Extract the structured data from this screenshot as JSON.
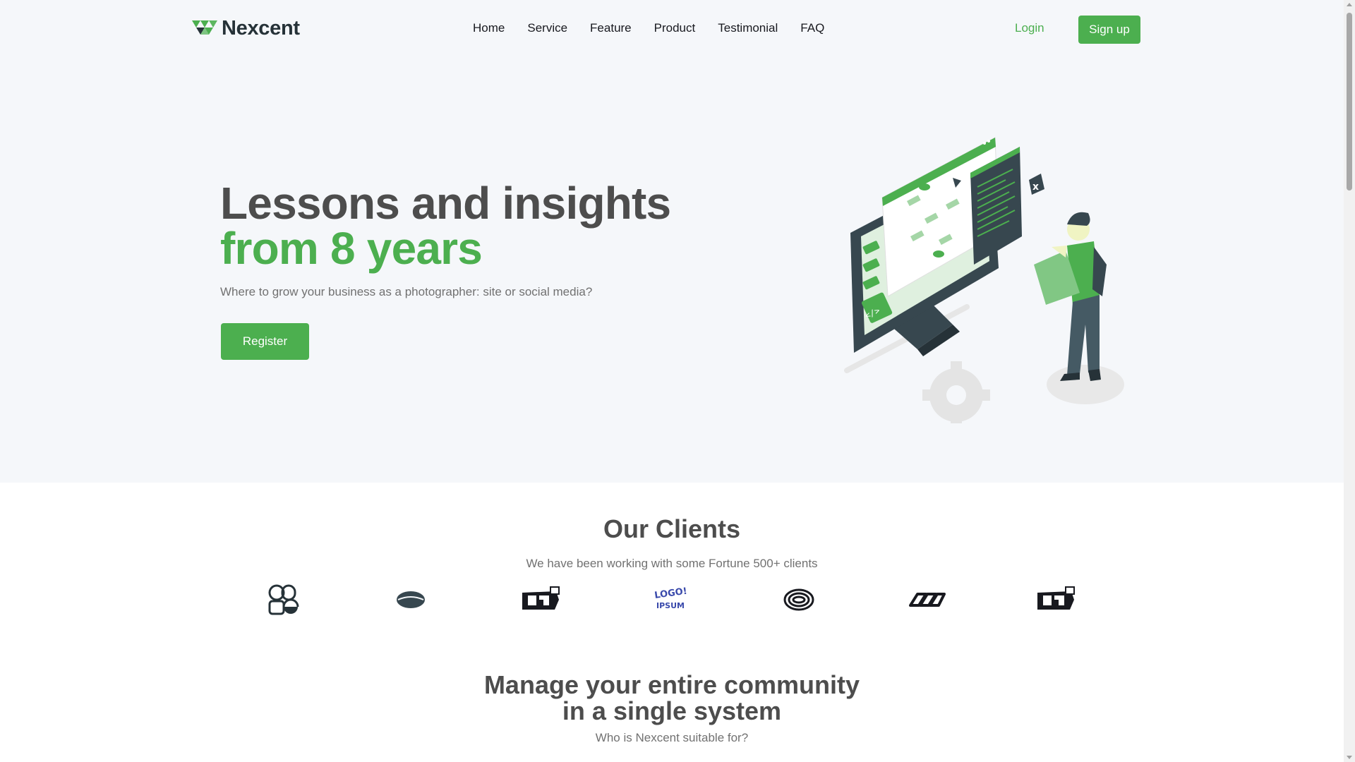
{
  "brand": {
    "name": "Nexcent",
    "logo_icon": "triangles-logo-icon",
    "accent_color": "#4caf4f"
  },
  "nav": {
    "links": [
      "Home",
      "Service",
      "Feature",
      "Product",
      "Testimonial",
      "FAQ"
    ],
    "login_label": "Login",
    "signup_label": "Sign up"
  },
  "hero": {
    "title_line1": "Lessons and insights",
    "title_line2": "from 8 years",
    "subtitle": "Where to grow your business as a photographer: site or social media?",
    "register_label": "Register",
    "illustration": "developer-monitor-illustration"
  },
  "clients": {
    "title": "Our Clients",
    "subtitle": "We have been working with some Fortune 500+ clients",
    "logos": [
      "client-logo-1",
      "client-logo-2",
      "client-logo-3",
      "client-logo-4",
      "client-logo-5",
      "client-logo-6",
      "client-logo-7"
    ],
    "logo4_text_top": "LOGO!",
    "logo4_text_bottom": "IPSUM"
  },
  "manage": {
    "title_line1": "Manage your entire community",
    "title_line2": "in a single system",
    "subtitle": "Who is Nexcent suitable for?"
  }
}
